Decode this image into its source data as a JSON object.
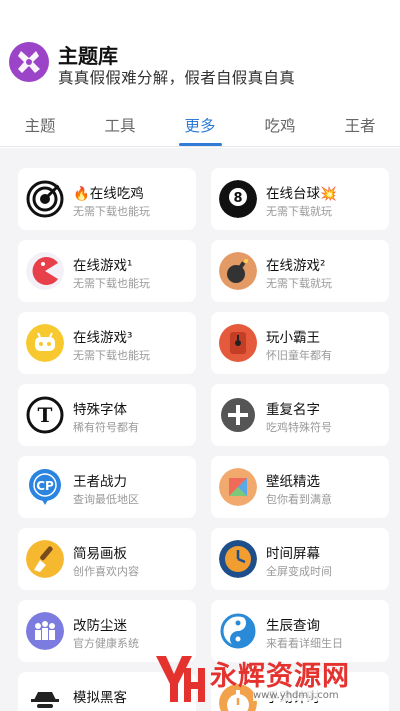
{
  "header": {
    "title": "主题库",
    "subtitle": "真真假假难分解，假者自假真自真"
  },
  "tabs": [
    {
      "label": "主题",
      "active": false
    },
    {
      "label": "工具",
      "active": false
    },
    {
      "label": "更多",
      "active": true
    },
    {
      "label": "吃鸡",
      "active": false
    },
    {
      "label": "王者",
      "active": false
    }
  ],
  "cards": [
    {
      "title": "🔥在线吃鸡",
      "subtitle": "无需下载也能玩",
      "icon": "target-icon"
    },
    {
      "title": "在线台球💥",
      "subtitle": "无需下载就玩",
      "icon": "billiard-8-ball-icon"
    },
    {
      "title": "在线游戏¹",
      "subtitle": "无需下载也能玩",
      "icon": "pacman-icon"
    },
    {
      "title": "在线游戏²",
      "subtitle": "无需下载就玩",
      "icon": "bomb-icon"
    },
    {
      "title": "在线游戏³",
      "subtitle": "无需下载也能玩",
      "icon": "robot-icon"
    },
    {
      "title": "玩小霸王",
      "subtitle": "怀旧童年都有",
      "icon": "game-console-icon"
    },
    {
      "title": "特殊字体",
      "subtitle": "稀有符号都有",
      "icon": "font-t-icon"
    },
    {
      "title": "重复名字",
      "subtitle": "吃鸡特殊符号",
      "icon": "plus-icon"
    },
    {
      "title": "王者战力",
      "subtitle": "查询最低地区",
      "icon": "cp-badge-icon"
    },
    {
      "title": "壁纸精选",
      "subtitle": "包你看到满意",
      "icon": "wallpaper-icon"
    },
    {
      "title": "简易画板",
      "subtitle": "创作喜欢内容",
      "icon": "paint-brush-icon"
    },
    {
      "title": "时间屏幕",
      "subtitle": "全屏变成时间",
      "icon": "clock-icon"
    },
    {
      "title": "改防尘迷",
      "subtitle": "官方健康系统",
      "icon": "family-icon"
    },
    {
      "title": "生辰查询",
      "subtitle": "来看看详细生日",
      "icon": "yin-yang-icon"
    },
    {
      "title": "模拟黑客",
      "subtitle": "",
      "icon": "hacker-icon"
    },
    {
      "title": "手动计时",
      "subtitle": "",
      "icon": "stopwatch-icon"
    }
  ],
  "watermark": {
    "text": "永辉资源网",
    "url": "www.yhdm.j.com"
  },
  "colors": {
    "accent": "#2f7bd6",
    "background": "#f4f4f6",
    "logo": "#9b44c8",
    "watermark": "#e4332f"
  }
}
